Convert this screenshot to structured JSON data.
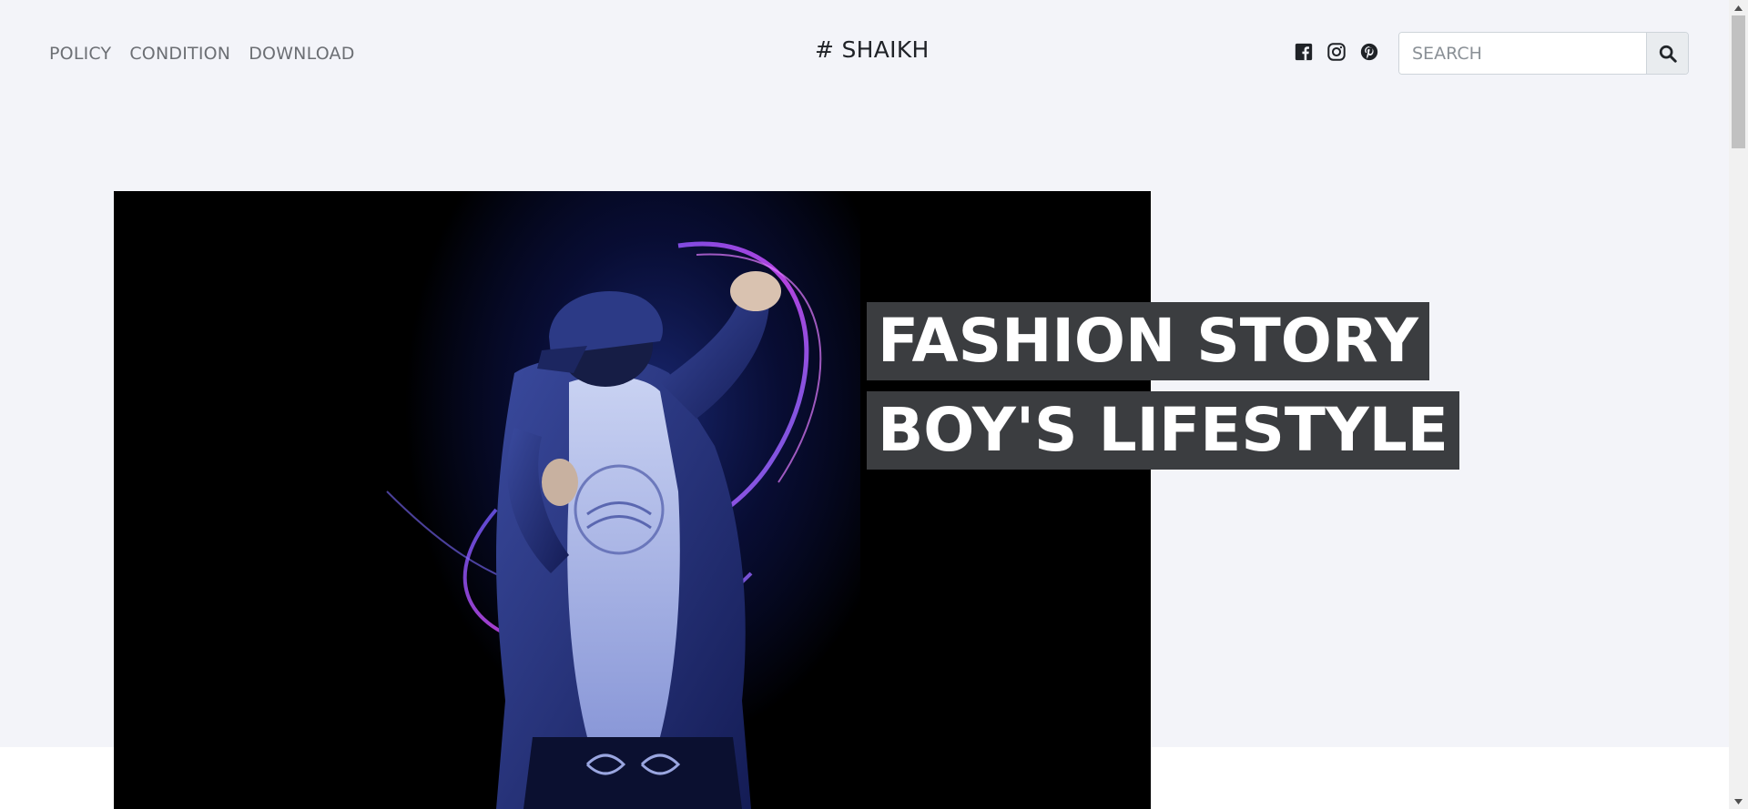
{
  "nav": {
    "links": [
      "POLICY",
      "CONDITION",
      "DOWNLOAD"
    ],
    "brand": "# SHAIKH",
    "social": [
      "facebook-icon",
      "instagram-icon",
      "pinterest-icon"
    ],
    "search": {
      "placeholder": "SEARCH",
      "value": ""
    }
  },
  "hero": {
    "line1": "FASHION STORY",
    "line2": "BOY'S LIFESTYLE",
    "image_subject": "man in cap and blazer with glowing light streaks"
  },
  "colors": {
    "background": "#f3f4f9",
    "text_highlight": "#3b3d40",
    "brand_text": "#1f2227",
    "nav_text": "#6c6f74"
  }
}
